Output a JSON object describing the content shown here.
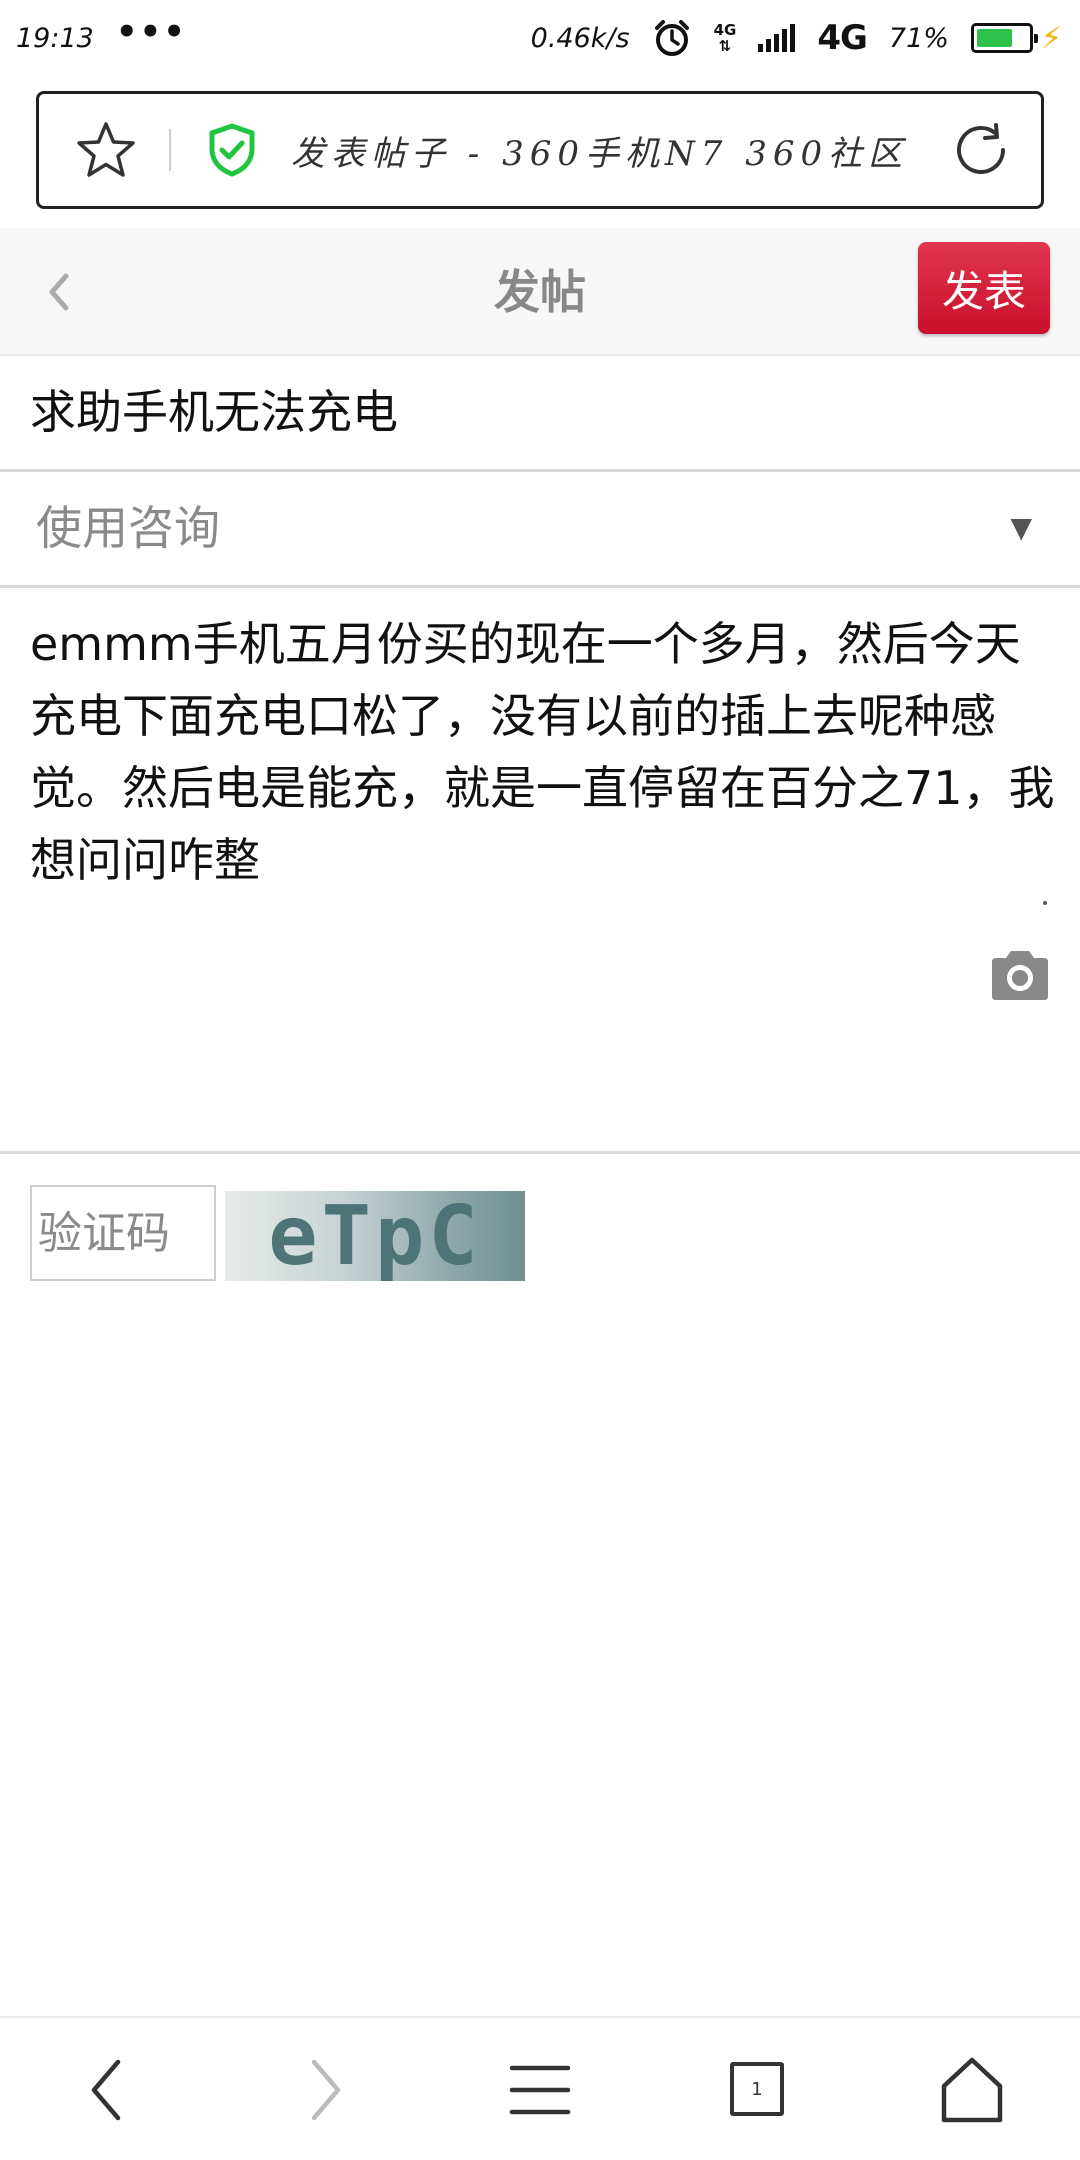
{
  "status_bar": {
    "time": "19:13",
    "dots": "•••",
    "network_speed": "0.46k/s",
    "network_small": "4G",
    "network_type": "4G",
    "battery_percent": "71%",
    "battery_level": 0.71,
    "icons": [
      "alarm-icon",
      "signal-icon",
      "battery-icon",
      "charging-icon"
    ]
  },
  "browser": {
    "page_title": "发表帖子 - 360手机N7 360社区",
    "icons": [
      "star-icon",
      "shield-check-icon",
      "refresh-icon"
    ],
    "shield_color": "#1fc441"
  },
  "header": {
    "title": "发帖",
    "publish_label": "发表",
    "accent_color": "#d2142f"
  },
  "form": {
    "subject": "求助手机无法充电",
    "category": "使用咨询",
    "body": "emmm手机五月份买的现在一个多月，然后今天充电下面充电口松了，没有以前的插上去呢种感觉。然后电是能充，就是一直停留在百分之71，我想问问咋整",
    "captcha_placeholder": "验证码",
    "captcha_text": "eTpC"
  },
  "bottom_nav": {
    "tab_count": "1",
    "icons": [
      "back-icon",
      "forward-icon",
      "menu-icon",
      "tabs-icon",
      "home-icon"
    ]
  }
}
